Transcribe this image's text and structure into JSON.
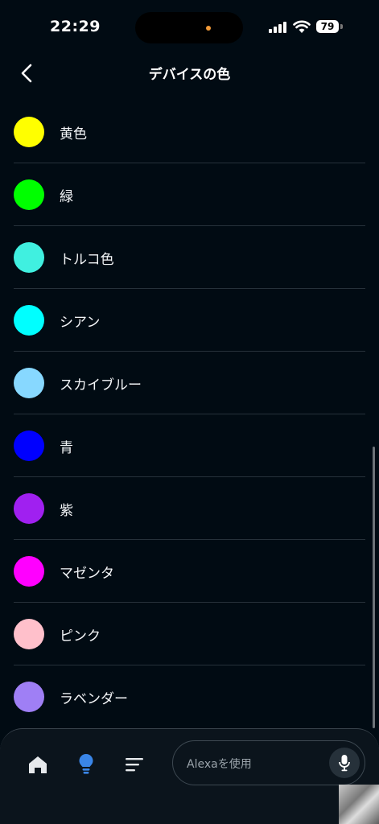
{
  "status": {
    "time": "22:29",
    "battery": "79"
  },
  "header": {
    "title": "デバイスの色"
  },
  "colors": [
    {
      "label": "黄色",
      "hex": "#ffff00"
    },
    {
      "label": "緑",
      "hex": "#00ff00"
    },
    {
      "label": "トルコ色",
      "hex": "#40f0e0"
    },
    {
      "label": "シアン",
      "hex": "#00ffff"
    },
    {
      "label": "スカイブルー",
      "hex": "#87d8ff"
    },
    {
      "label": "青",
      "hex": "#0000ff"
    },
    {
      "label": "紫",
      "hex": "#a020f0"
    },
    {
      "label": "マゼンタ",
      "hex": "#ff00ff"
    },
    {
      "label": "ピンク",
      "hex": "#ffc0cb"
    },
    {
      "label": "ラベンダー",
      "hex": "#9f7ff5"
    }
  ],
  "bottom_nav": {
    "items": [
      {
        "icon": "home-icon"
      },
      {
        "icon": "devices-bulb-icon",
        "active": true
      },
      {
        "icon": "more-menu-icon"
      }
    ],
    "alexa_placeholder": "Alexaを使用",
    "mic_icon": "microphone-icon"
  },
  "theme": {
    "background": "#010b13",
    "accent_blue": "#3a86e8"
  }
}
